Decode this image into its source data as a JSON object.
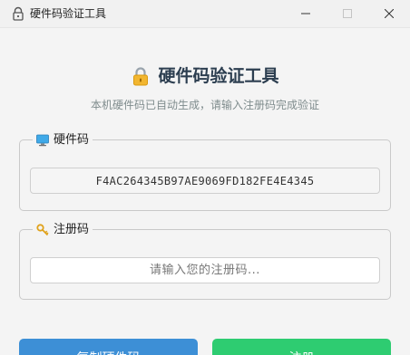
{
  "window": {
    "title": "硬件码验证工具"
  },
  "header": {
    "title": "硬件码验证工具",
    "subtitle": "本机硬件码已自动生成，请输入注册码完成验证"
  },
  "hardware_group": {
    "legend": "硬件码",
    "value": "F4AC264345B97AE9069FD182FE4E4345"
  },
  "register_group": {
    "legend": "注册码",
    "input_value": "",
    "placeholder": "请输入您的注册码..."
  },
  "buttons": {
    "copy_label": "复制硬件码",
    "register_label": "注册"
  },
  "colors": {
    "copy_button": "#3d8fd6",
    "register_button": "#2ecc71",
    "heading": "#2c3e50",
    "subtitle": "#7f8c8d"
  },
  "icons": {
    "app": "lock-icon",
    "heading": "lock-icon",
    "hardware": "monitor-icon",
    "register": "key-icon"
  }
}
